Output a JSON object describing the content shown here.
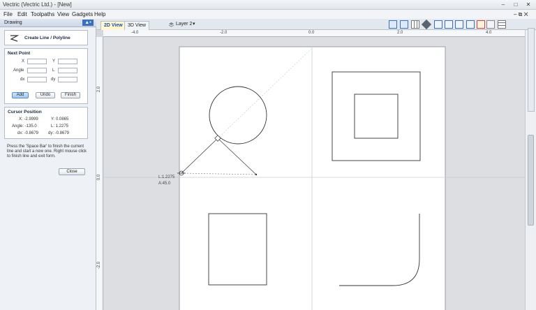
{
  "window": {
    "title": "Vectric (Vectric Ltd.) - [New]"
  },
  "menu": {
    "items": [
      "File",
      "Edit",
      "Toolpaths",
      "View",
      "Gadgets",
      "Help"
    ]
  },
  "panel": {
    "header": "Drawing",
    "tool_title": "Create Line / Polyline",
    "next_point": {
      "heading": "Next Point",
      "x_label": "X",
      "y_label": "Y",
      "angle_label": "Angle",
      "l_label": "L",
      "dx_label": "dx",
      "dy_label": "dy",
      "add": "Add",
      "undo": "Undo",
      "finish": "Finish"
    },
    "cursor": {
      "heading": "Cursor Position",
      "x": "X:   -2.9999",
      "y": "Y:   0.0865",
      "angle": "Angle:  -135.0",
      "l": "L:   1.2275",
      "dx": "dx:  -0.8679",
      "dy": "dy:  -0.8679"
    },
    "hint": "Press the 'Space Bar' to finish the current line and start a new one. Right mouse click to finish line and exit form.",
    "close": "Close"
  },
  "tabs": {
    "view2d": "2D View",
    "view3d": "3D View",
    "layer": "Layer 2"
  },
  "rulers": {
    "h": [
      "-4.0",
      "-2.0",
      "0.0",
      "2.0",
      "4.0"
    ],
    "v": [
      "2.0",
      "0.0",
      "-2.0"
    ]
  },
  "canvas": {
    "readout_l": "L:1.2275",
    "readout_a": "A:45.0"
  },
  "colors": {
    "accent": "#3a6fc0",
    "sheet": "#ffffff",
    "background": "#dcdee2"
  }
}
